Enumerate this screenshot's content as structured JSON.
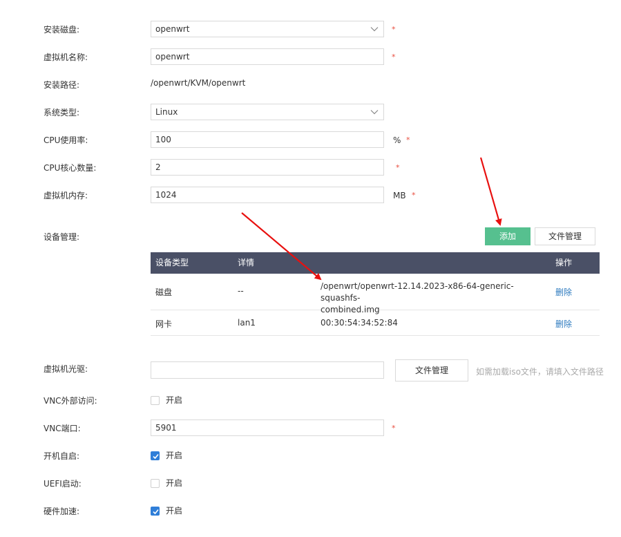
{
  "form": {
    "disk": {
      "label": "安装磁盘:",
      "value": "openwrt",
      "required": "*"
    },
    "vm_name": {
      "label": "虚拟机名称:",
      "value": "openwrt",
      "required": "*"
    },
    "install_path": {
      "label": "安装路径:",
      "value": "/openwrt/KVM/openwrt"
    },
    "os_type": {
      "label": "系统类型:",
      "value": "Linux"
    },
    "cpu_usage": {
      "label": "CPU使用率:",
      "value": "100",
      "unit": "%",
      "required": "*"
    },
    "cpu_cores": {
      "label": "CPU核心数量:",
      "value": "2",
      "required": "*"
    },
    "memory": {
      "label": "虚拟机内存:",
      "value": "1024",
      "unit": "MB",
      "required": "*"
    }
  },
  "devices": {
    "label": "设备管理:",
    "add_button": "添加",
    "file_button": "文件管理",
    "columns": [
      "设备类型",
      "详情",
      "",
      "操作"
    ],
    "rows": [
      {
        "type": "磁盘",
        "detail": "--",
        "info_line1": "/openwrt/openwrt-12.14.2023-x86-64-generic-squashfs-",
        "info_line2": "combined.img",
        "action": "删除"
      },
      {
        "type": "网卡",
        "detail": "lan1",
        "info_line1": "00:30:54:34:52:84",
        "info_line2": "",
        "action": "删除"
      }
    ]
  },
  "cdrom": {
    "label": "虚拟机光驱:",
    "value": "",
    "file_button": "文件管理",
    "hint": "如需加载iso文件，请填入文件路径"
  },
  "vnc_external": {
    "label": "VNC外部访问:",
    "checked": false,
    "text": "开启"
  },
  "vnc_port": {
    "label": "VNC端口:",
    "value": "5901",
    "required": "*"
  },
  "autostart": {
    "label": "开机自启:",
    "checked": true,
    "text": "开启"
  },
  "uefi": {
    "label": "UEFI启动:",
    "checked": false,
    "text": "开启"
  },
  "hw_accel": {
    "label": "硬件加速:",
    "checked": true,
    "text": "开启"
  },
  "colors": {
    "accent_green": "#56c08f",
    "table_header": "#4a5066",
    "link_blue": "#2e7bbf",
    "required_red": "#e84c3d",
    "arrow_red": "#e8100f",
    "checkbox_blue": "#2f7ed8"
  }
}
